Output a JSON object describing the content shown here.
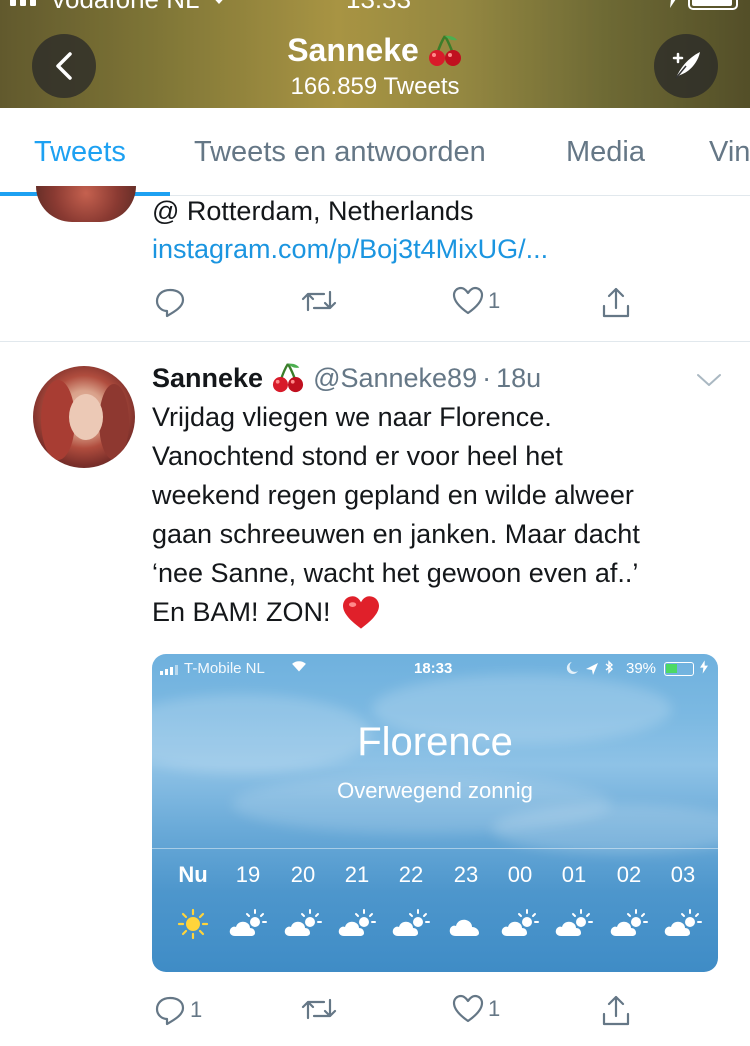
{
  "status_bar": {
    "carrier": "vodafone NL",
    "time": "13:33"
  },
  "header": {
    "name": "Sanneke",
    "tweet_count": "166.859 Tweets"
  },
  "tabs": [
    {
      "label": "Tweets",
      "active": true
    },
    {
      "label": "Tweets en antwoorden",
      "active": false
    },
    {
      "label": "Media",
      "active": false
    },
    {
      "label": "Vin",
      "active": false
    }
  ],
  "tweet1": {
    "location": "@ Rotterdam, Netherlands",
    "link": "instagram.com/p/Boj3t4MixUG/...",
    "like_count": "1"
  },
  "tweet2": {
    "name": "Sanneke",
    "handle": "@Sanneke89",
    "separator": "·",
    "time": "18u",
    "text_lines": [
      "Vrijdag vliegen we naar Florence.",
      "Vanochtend stond er voor heel het",
      "weekend regen gepland en wilde alweer",
      "gaan schreeuwen en janken. Maar dacht",
      "‘nee Sanne, wacht het gewoon even af..’",
      "En BAM! ZON!"
    ],
    "reply_count": "1",
    "like_count": "1",
    "media": {
      "carrier": "T-Mobile NL",
      "time": "18:33",
      "battery": "39%",
      "city": "Florence",
      "condition": "Overwegend zonnig",
      "hours": [
        "Nu",
        "19",
        "20",
        "21",
        "22",
        "23",
        "00",
        "01",
        "02",
        "03"
      ],
      "icons": [
        "sun-icon",
        "partly-cloudy-icon",
        "partly-cloudy-icon",
        "partly-cloudy-icon",
        "partly-cloudy-icon",
        "cloud-icon",
        "partly-cloudy-icon",
        "partly-cloudy-icon",
        "partly-cloudy-icon",
        "partly-cloudy-icon"
      ]
    }
  },
  "colors": {
    "accent": "#1da1f2",
    "link": "#1b95e0",
    "muted": "#657786",
    "text": "#14171a",
    "heart": "#e0245e"
  }
}
